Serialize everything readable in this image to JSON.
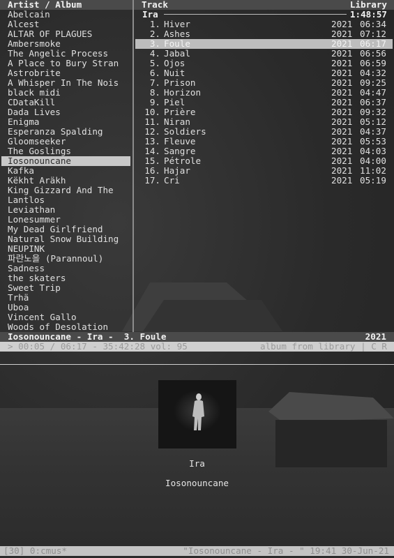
{
  "header": {
    "left": "Artist / Album",
    "mid": "Track",
    "right": "Library"
  },
  "artists": [
    "Abelcain",
    "Alcest",
    "ALTAR OF PLAGUES",
    "Ambersmoke",
    "The Angelic Process",
    "A Place to Bury Stran",
    "Astrobrite",
    "A Whisper In The Nois",
    "black midi",
    "CDataKill",
    "Dada Lives",
    "Enigma",
    "Esperanza Spalding",
    "Gloomseeker",
    "The Goslings",
    "Iosonouncane",
    "Kafka",
    "Këkht Aräkh",
    "King Gizzard And The",
    "Lantlos",
    "Leviathan",
    "Lonesummer",
    "My Dead Girlfriend",
    "Natural Snow Building",
    "NEUPINK",
    "파란노을 (Parannoul)",
    "Sadness",
    "the skaters",
    "Sweet Trip",
    "Trhä",
    "Uboa",
    "Vincent Gallo",
    "Woods of Desolation"
  ],
  "selected_artist_index": 15,
  "album": {
    "name": "Ira",
    "duration": "1:48:57"
  },
  "tracks": [
    {
      "num": "1.",
      "title": "Hiver",
      "year": "2021",
      "dur": "06:34"
    },
    {
      "num": "2.",
      "title": "Ashes",
      "year": "2021",
      "dur": "07:12"
    },
    {
      "num": "3.",
      "title": "Foule",
      "year": "2021",
      "dur": "06:17"
    },
    {
      "num": "4.",
      "title": "Jabal",
      "year": "2021",
      "dur": "06:56"
    },
    {
      "num": "5.",
      "title": "Ojos",
      "year": "2021",
      "dur": "06:59"
    },
    {
      "num": "6.",
      "title": "Nuit",
      "year": "2021",
      "dur": "04:32"
    },
    {
      "num": "7.",
      "title": "Prison",
      "year": "2021",
      "dur": "09:25"
    },
    {
      "num": "8.",
      "title": "Horizon",
      "year": "2021",
      "dur": "04:47"
    },
    {
      "num": "9.",
      "title": "Piel",
      "year": "2021",
      "dur": "06:37"
    },
    {
      "num": "10.",
      "title": "Prière",
      "year": "2021",
      "dur": "09:32"
    },
    {
      "num": "11.",
      "title": "Niran",
      "year": "2021",
      "dur": "05:12"
    },
    {
      "num": "12.",
      "title": "Soldiers",
      "year": "2021",
      "dur": "04:37"
    },
    {
      "num": "13.",
      "title": "Fleuve",
      "year": "2021",
      "dur": "05:53"
    },
    {
      "num": "14.",
      "title": "Sangre",
      "year": "2021",
      "dur": "04:03"
    },
    {
      "num": "15.",
      "title": "Pétrole",
      "year": "2021",
      "dur": "04:00"
    },
    {
      "num": "16.",
      "title": "Hajar",
      "year": "2021",
      "dur": "11:02"
    },
    {
      "num": "17.",
      "title": "Cri",
      "year": "2021",
      "dur": "05:19"
    }
  ],
  "selected_track_index": 2,
  "status": {
    "now_playing": "Iosonouncane - Ira -  3. Foule",
    "year": "2021"
  },
  "info": {
    "left": "> 00:05 / 06:17 - 35:42:28 vol: 95",
    "right": "album from library | C R"
  },
  "cover": {
    "title": "Ira",
    "artist": "Iosonouncane"
  },
  "tmux": {
    "left": "[30] 0:cmus*",
    "right": "\"Iosonouncane - Ira - \" 19:41 30-Jun-21"
  }
}
